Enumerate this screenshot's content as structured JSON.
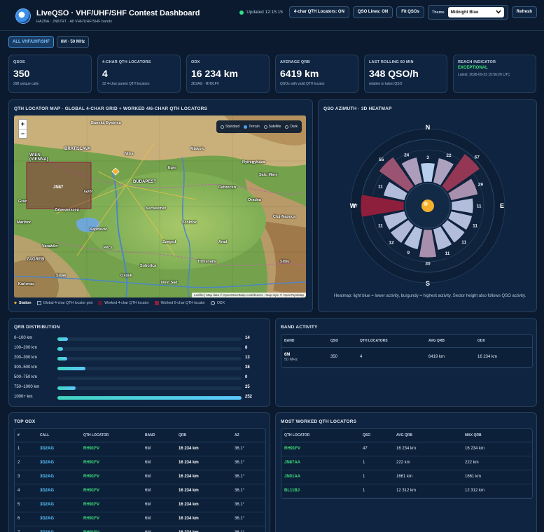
{
  "header": {
    "title": "LiveQSO · VHF/UHF/SHF Contest Dashboard",
    "subtitle": "HA2NA · JN87RT · All VHF/UHF/SHF bands",
    "updated": "Updated 12:15:15",
    "locators_toggle": "4-char QTH Locators: ON",
    "qso_lines_toggle": "QSO Lines: ON",
    "fit_button": "Fit QSOs",
    "theme_label": "Theme",
    "theme_value": "Midnight Blue",
    "refresh_button": "Refresh"
  },
  "bands": [
    "ALL VHF/UHF/SHF",
    "6M · 50 MHz"
  ],
  "stats": [
    {
      "label": "QSOS",
      "value": "350",
      "sub": "298 unique calls"
    },
    {
      "label": "4-CHAR QTH LOCATORS",
      "value": "4",
      "sub": "32 4-char parent QTH locators"
    },
    {
      "label": "ODX",
      "value": "16 234 km",
      "sub": "3D2AG · RH91FV"
    },
    {
      "label": "AVERAGE QRB",
      "value": "6419 km",
      "sub": "QSOs with valid QTH locator"
    },
    {
      "label": "LAST ROLLING 60 MIN",
      "value": "348 QSO/h",
      "sub": "relative to latest QSO"
    },
    {
      "label": "REACH INDICATOR",
      "value": "EXCEPTIONAL",
      "sub": "Latest: 2026-09-23 15:56:20 UTC"
    }
  ],
  "map": {
    "title": "QTH LOCATOR MAP · GLOBAL 4-CHAR GRID + WORKED 4/6-CHAR QTH LOCATORS",
    "styles": [
      "Standard",
      "Terrain",
      "Satellite",
      "Dark"
    ],
    "active_style": "Terrain",
    "attribution": "Leaflet | Map data © OpenStreetMap contributors · Map style © OpenTopoMap",
    "cities": [
      "Banská Bystrica",
      "BRATISLAVA",
      "WIEN (VIENNA)",
      "BUDAPEST",
      "Szeged",
      "Debrecen",
      "ZAGREB",
      "Pécs",
      "Subotica",
      "Kecskemét",
      "Győr",
      "Oradea",
      "Arad",
      "Novi Sad",
      "Miskolc",
      "Nyíregyháza",
      "Timișoara",
      "Cluj-Napoca",
      "Sibiu",
      "Košice",
      "Zalaegerszeg",
      "Osijek",
      "Karlovac",
      "Sisak",
      "Graz",
      "Maribor",
      "Varaždin",
      "Kaposvár",
      "Szolnok",
      "Nitra",
      "Eger",
      "Satu Mare"
    ],
    "grid_label": "JN87",
    "legend": [
      "Station",
      "Global 4-char QTH locator grid",
      "Worked 4-char QTH locator",
      "Worked 6-char QTH locator",
      "ODX"
    ]
  },
  "azimuth": {
    "title": "QSO AZIMUTH · 3D HEATMAP",
    "compass": [
      "N",
      "E",
      "S",
      "W"
    ],
    "note": "Heatmap: light blue = lower activity, burgundy = highest activity. Sector height also follows QSO activity.",
    "sectors": [
      3,
      22,
      67,
      29,
      11,
      11,
      11,
      11,
      30,
      9,
      12,
      11,
      77,
      11,
      55,
      24
    ]
  },
  "qrb": {
    "title": "QRB DISTRIBUTION",
    "max": 252,
    "rows": [
      {
        "label": "0–100 km",
        "count": 14
      },
      {
        "label": "100–200 km",
        "count": 8
      },
      {
        "label": "200–300 km",
        "count": 13
      },
      {
        "label": "300–500 km",
        "count": 38
      },
      {
        "label": "500–750 km",
        "count": 0
      },
      {
        "label": "750–1000 km",
        "count": 25
      },
      {
        "label": "1000+ km",
        "count": 252
      }
    ]
  },
  "band_activity": {
    "title": "BAND ACTIVITY",
    "headers": [
      "BAND",
      "QSO",
      "QTH LOCATORS",
      "AVG QRB",
      "ODX"
    ],
    "rows": [
      {
        "band": "6M",
        "freq": "50 MHz",
        "qso": "350",
        "locators": "4",
        "avg": "6419 km",
        "odx": "16 234 km"
      }
    ]
  },
  "top_odx": {
    "title": "TOP ODX",
    "headers": [
      "#",
      "CALL",
      "QTH LOCATOR",
      "BAND",
      "QRB",
      "AZ"
    ],
    "rows": [
      {
        "n": "1",
        "call": "3D2AG",
        "loc": "RH91FV",
        "band": "6M",
        "qrb": "16 234 km",
        "az": "36.1°"
      },
      {
        "n": "2",
        "call": "3D2AG",
        "loc": "RH91FV",
        "band": "6M",
        "qrb": "16 234 km",
        "az": "36.1°"
      },
      {
        "n": "3",
        "call": "3D2AG",
        "loc": "RH91FV",
        "band": "6M",
        "qrb": "16 234 km",
        "az": "36.1°"
      },
      {
        "n": "4",
        "call": "3D2AG",
        "loc": "RH91FV",
        "band": "6M",
        "qrb": "16 234 km",
        "az": "36.1°"
      },
      {
        "n": "5",
        "call": "3D2AG",
        "loc": "RH91FV",
        "band": "6M",
        "qrb": "16 234 km",
        "az": "36.1°"
      },
      {
        "n": "6",
        "call": "3D2AG",
        "loc": "RH91FV",
        "band": "6M",
        "qrb": "16 234 km",
        "az": "36.1°"
      },
      {
        "n": "7",
        "call": "3D2AG",
        "loc": "RH91FV",
        "band": "6M",
        "qrb": "16 234 km",
        "az": "36.1°"
      }
    ]
  },
  "most_worked": {
    "title": "MOST WORKED QTH LOCATORS",
    "headers": [
      "QTH LOCATOR",
      "QSO",
      "AVG QRB",
      "MAX QRB"
    ],
    "rows": [
      {
        "loc": "RH91FV",
        "qso": "47",
        "avg": "16 234 km",
        "max": "16 234 km"
      },
      {
        "loc": "JN87AA",
        "qso": "1",
        "avg": "222 km",
        "max": "222 km"
      },
      {
        "loc": "JN01AA",
        "qso": "1",
        "avg": "1661 km",
        "max": "1661 km"
      },
      {
        "loc": "BL11BJ",
        "qso": "1",
        "avg": "12 312 km",
        "max": "12 312 km"
      }
    ]
  },
  "colors": {
    "accent": "#5cc7ff",
    "locator": "#3ee07a",
    "burgundy": "#8e1f3c"
  }
}
